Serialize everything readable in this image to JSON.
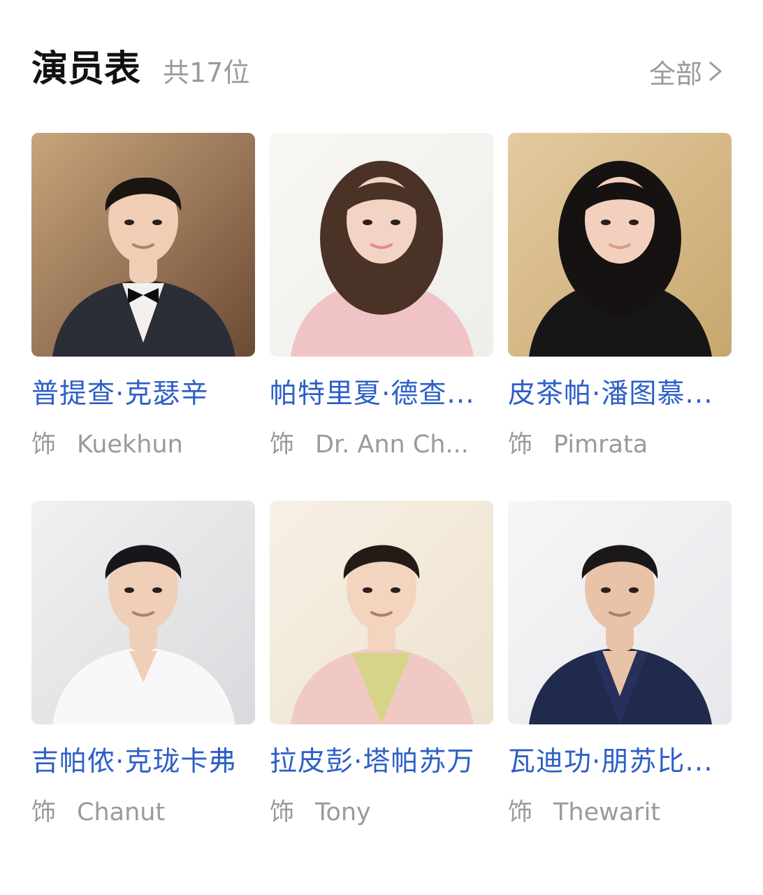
{
  "header": {
    "title": "演员表",
    "count": "共17位",
    "all_label": "全部"
  },
  "cast": [
    {
      "name": "普提查·克瑟辛",
      "role_prefix": "饰",
      "role": "Kuekhun",
      "photo": {
        "bg": "#6b4a35",
        "bg2": "#c9a57c",
        "hair": "#1b1512",
        "skin": "#f0cdb5",
        "top": "#2b2e36",
        "accent": "#f4f1ec",
        "style": "male-suit-bowtie"
      }
    },
    {
      "name": "帕特里夏·德查...",
      "role_prefix": "饰",
      "role": "Dr. Ann Ch...",
      "photo": {
        "bg": "#eeeeea",
        "bg2": "#f8f7f4",
        "hair": "#4a3226",
        "skin": "#f3d4c4",
        "top": "#f0c4c6",
        "accent": "#e8868e",
        "style": "female-wavy-bob"
      }
    },
    {
      "name": "皮茶帕·潘图慕...",
      "role_prefix": "饰",
      "role": "Pimrata",
      "photo": {
        "bg": "#c8a76e",
        "bg2": "#e3caa0",
        "hair": "#161211",
        "skin": "#f2d0bd",
        "top": "#161617",
        "accent": "#d99a8c",
        "style": "female-dark-curls"
      }
    },
    {
      "name": "吉帕侬·克珑卡弗",
      "role_prefix": "饰",
      "role": "Chanut",
      "photo": {
        "bg": "#d9dadd",
        "bg2": "#f1f1f2",
        "hair": "#18161a",
        "skin": "#efcfb8",
        "top": "#f8f8f8",
        "accent": "#e2e2e2",
        "style": "male-white-shirt"
      }
    },
    {
      "name": "拉皮彭·塔帕苏万",
      "role_prefix": "饰",
      "role": "Tony",
      "photo": {
        "bg": "#ede2cf",
        "bg2": "#f7f0e4",
        "hair": "#241a16",
        "skin": "#f2d4bf",
        "top": "#f0c9c4",
        "accent": "#d6d489",
        "style": "male-pink-blazer"
      }
    },
    {
      "name": "瓦迪功·朋苏比...",
      "role_prefix": "饰",
      "role": "Thewarit",
      "photo": {
        "bg": "#e8e8ec",
        "bg2": "#f6f6f8",
        "hair": "#1a1718",
        "skin": "#e9c3a7",
        "top": "#1f2a4d",
        "accent": "#26305a",
        "style": "male-navy-blazer"
      }
    }
  ]
}
